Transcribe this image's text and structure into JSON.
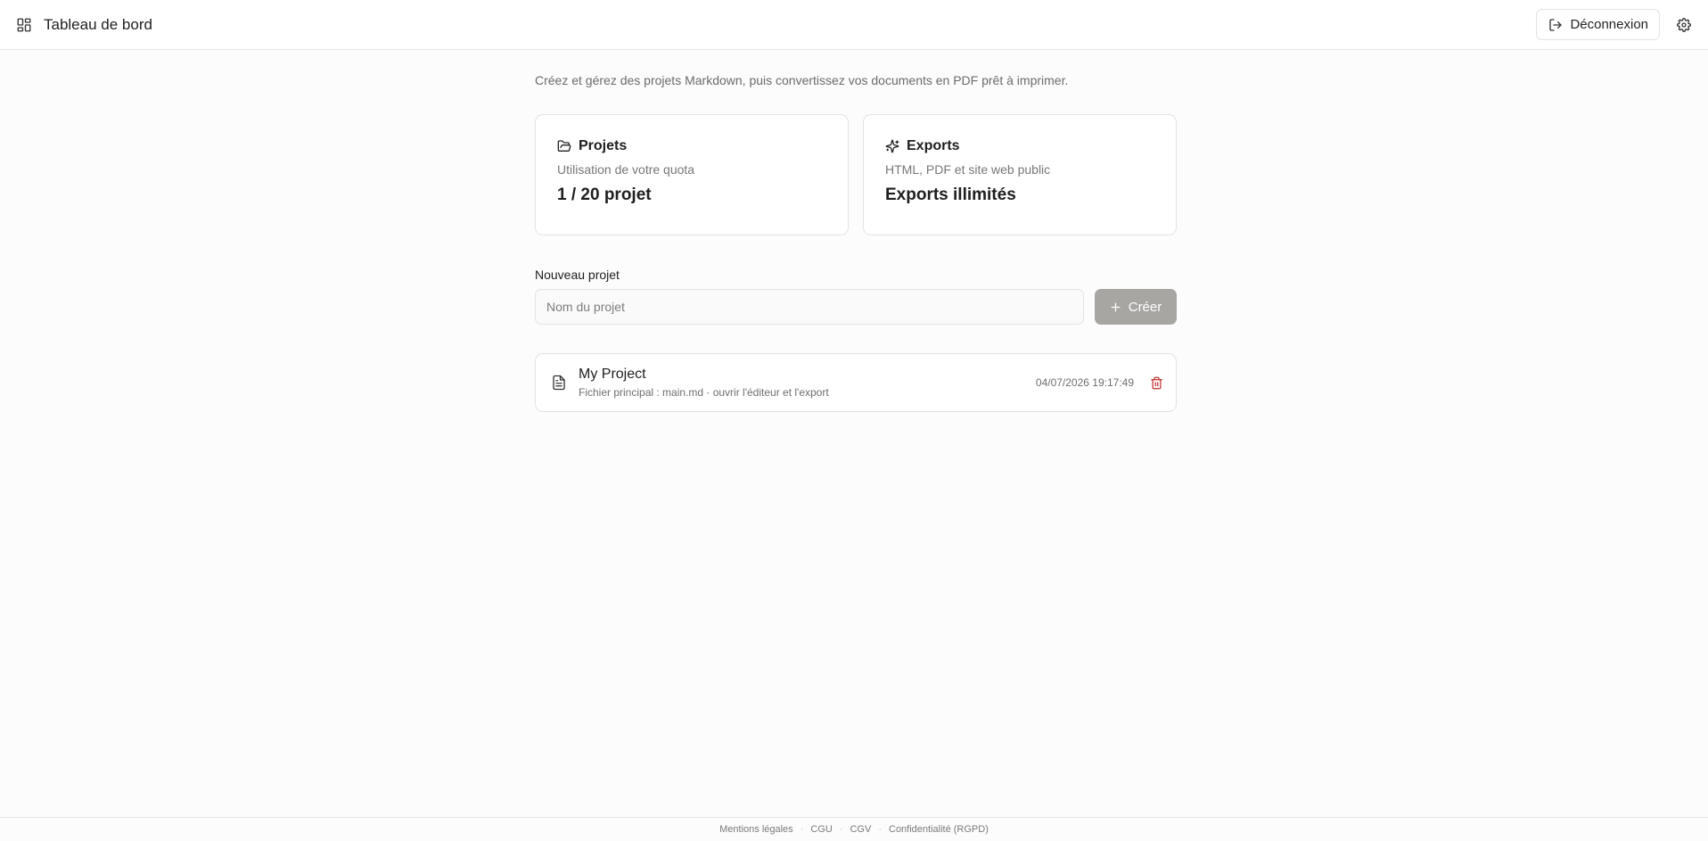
{
  "header": {
    "title": "Tableau de bord",
    "logout_label": "Déconnexion",
    "icons": {
      "dashboard": "layout-dashboard-icon",
      "logout": "log-out-icon",
      "settings": "gear-icon"
    }
  },
  "intro": "Créez et gérez des projets Markdown, puis convertissez vos documents en PDF prêt à imprimer.",
  "cards": {
    "projects": {
      "title": "Projets",
      "subtitle": "Utilisation de votre quota",
      "value": "1 / 20 projet",
      "icon": "folder-open-icon"
    },
    "exports": {
      "title": "Exports",
      "subtitle": "HTML, PDF et site web public",
      "value": "Exports illimités",
      "icon": "sparkles-icon"
    }
  },
  "new_project": {
    "label": "Nouveau projet",
    "placeholder": "Nom du projet",
    "value": "",
    "create_label": "Créer"
  },
  "projects": [
    {
      "name": "My Project",
      "meta": "Fichier principal : main.md · ouvrir l'éditeur et l'export",
      "date": "04/07/2026 19:17:49",
      "icon": "file-text-icon"
    }
  ],
  "footer": {
    "links": [
      "Mentions légales",
      "CGU",
      "CGV",
      "Confidentialité (RGPD)"
    ],
    "separator": "·"
  },
  "colors": {
    "background": "#fcfcfc",
    "border": "#e3e3e3",
    "create_button": "#a8a6a2",
    "delete_icon": "#c53030",
    "muted_text": "#6b6b6b"
  }
}
